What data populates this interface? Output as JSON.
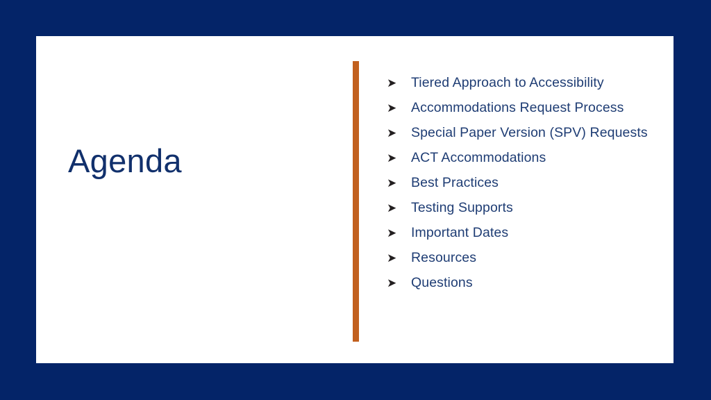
{
  "slide": {
    "background_color": "#042468",
    "card_color": "#ffffff",
    "title": "Agenda",
    "title_color": "#11306c",
    "divider": {
      "color": "#c2601e",
      "name": "orange-vertical-divider"
    },
    "bullet_marker": "➤",
    "bullet_text_color": "#1f3d74",
    "bullets": [
      {
        "text": "Tiered Approach to Accessibility"
      },
      {
        "text": "Accommodations Request Process"
      },
      {
        "text": "Special Paper Version (SPV) Requests"
      },
      {
        "text": "ACT Accommodations"
      },
      {
        "text": "Best Practices"
      },
      {
        "text": "Testing Supports"
      },
      {
        "text": "Important Dates"
      },
      {
        "text": "Resources"
      },
      {
        "text": "Questions"
      }
    ]
  }
}
